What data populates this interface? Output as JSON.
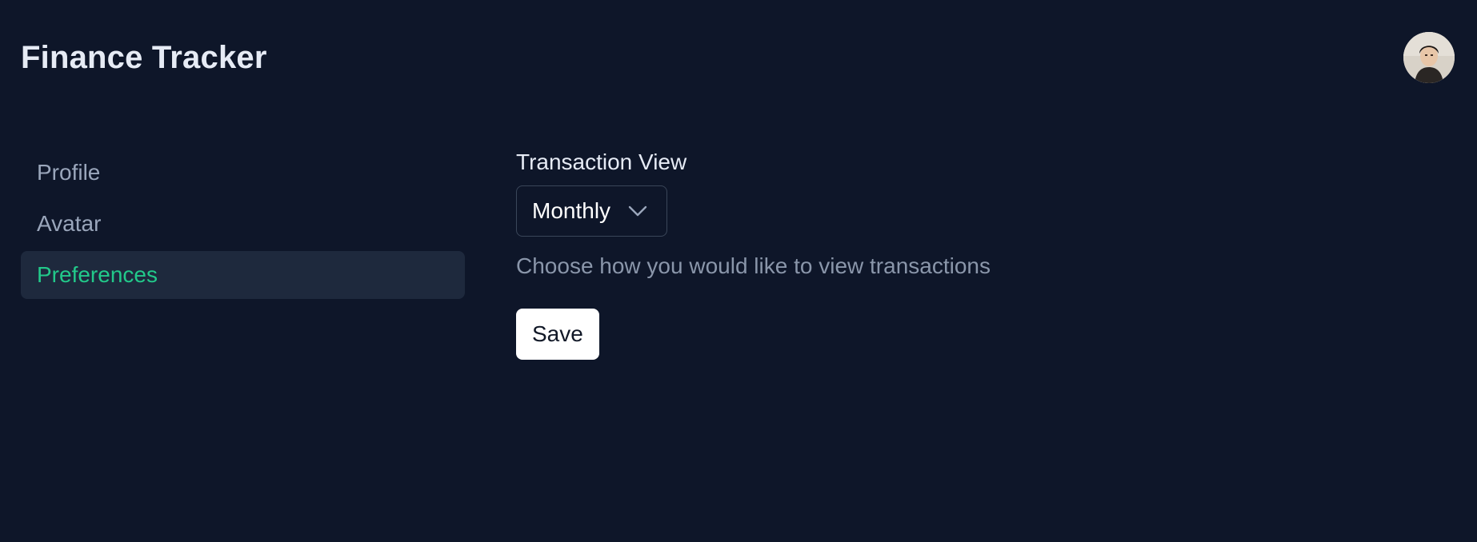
{
  "app": {
    "title": "Finance Tracker"
  },
  "header": {
    "avatar_icon": "user-avatar-photo"
  },
  "sidebar": {
    "items": [
      {
        "label": "Profile",
        "active": false
      },
      {
        "label": "Avatar",
        "active": false
      },
      {
        "label": "Preferences",
        "active": true
      }
    ]
  },
  "preferences": {
    "transaction_view": {
      "label": "Transaction View",
      "selected": "Monthly",
      "help": "Choose how you would like to view transactions",
      "icon": "chevron-down-icon"
    },
    "save_label": "Save"
  },
  "colors": {
    "background": "#0e1629",
    "active_nav_bg": "#1e293d",
    "accent": "#22c98a",
    "muted_text": "#9aa6bb"
  }
}
